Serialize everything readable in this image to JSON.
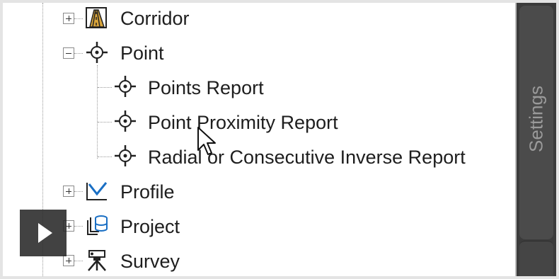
{
  "tree": {
    "items": [
      {
        "label": "Corridor",
        "state": "collapsed",
        "icon": "corridor-icon"
      },
      {
        "label": "Point",
        "state": "expanded",
        "icon": "point-icon",
        "children": [
          {
            "label": "Points Report",
            "icon": "point-icon"
          },
          {
            "label": "Point Proximity Report",
            "icon": "point-icon"
          },
          {
            "label": "Radial or Consecutive Inverse Report",
            "icon": "point-icon"
          }
        ]
      },
      {
        "label": "Profile",
        "state": "collapsed",
        "icon": "profile-icon"
      },
      {
        "label": "Project",
        "state": "collapsed",
        "icon": "project-icon"
      },
      {
        "label": "Survey",
        "state": "collapsed",
        "icon": "survey-icon"
      }
    ]
  },
  "side_panel": {
    "tab_label": "Settings"
  },
  "overlay": {
    "play_icon": "play-icon"
  },
  "colors": {
    "panel_dark": "#3b3b3b",
    "tab": "#4b4b4b",
    "profile_blue": "#1a6fc4"
  }
}
